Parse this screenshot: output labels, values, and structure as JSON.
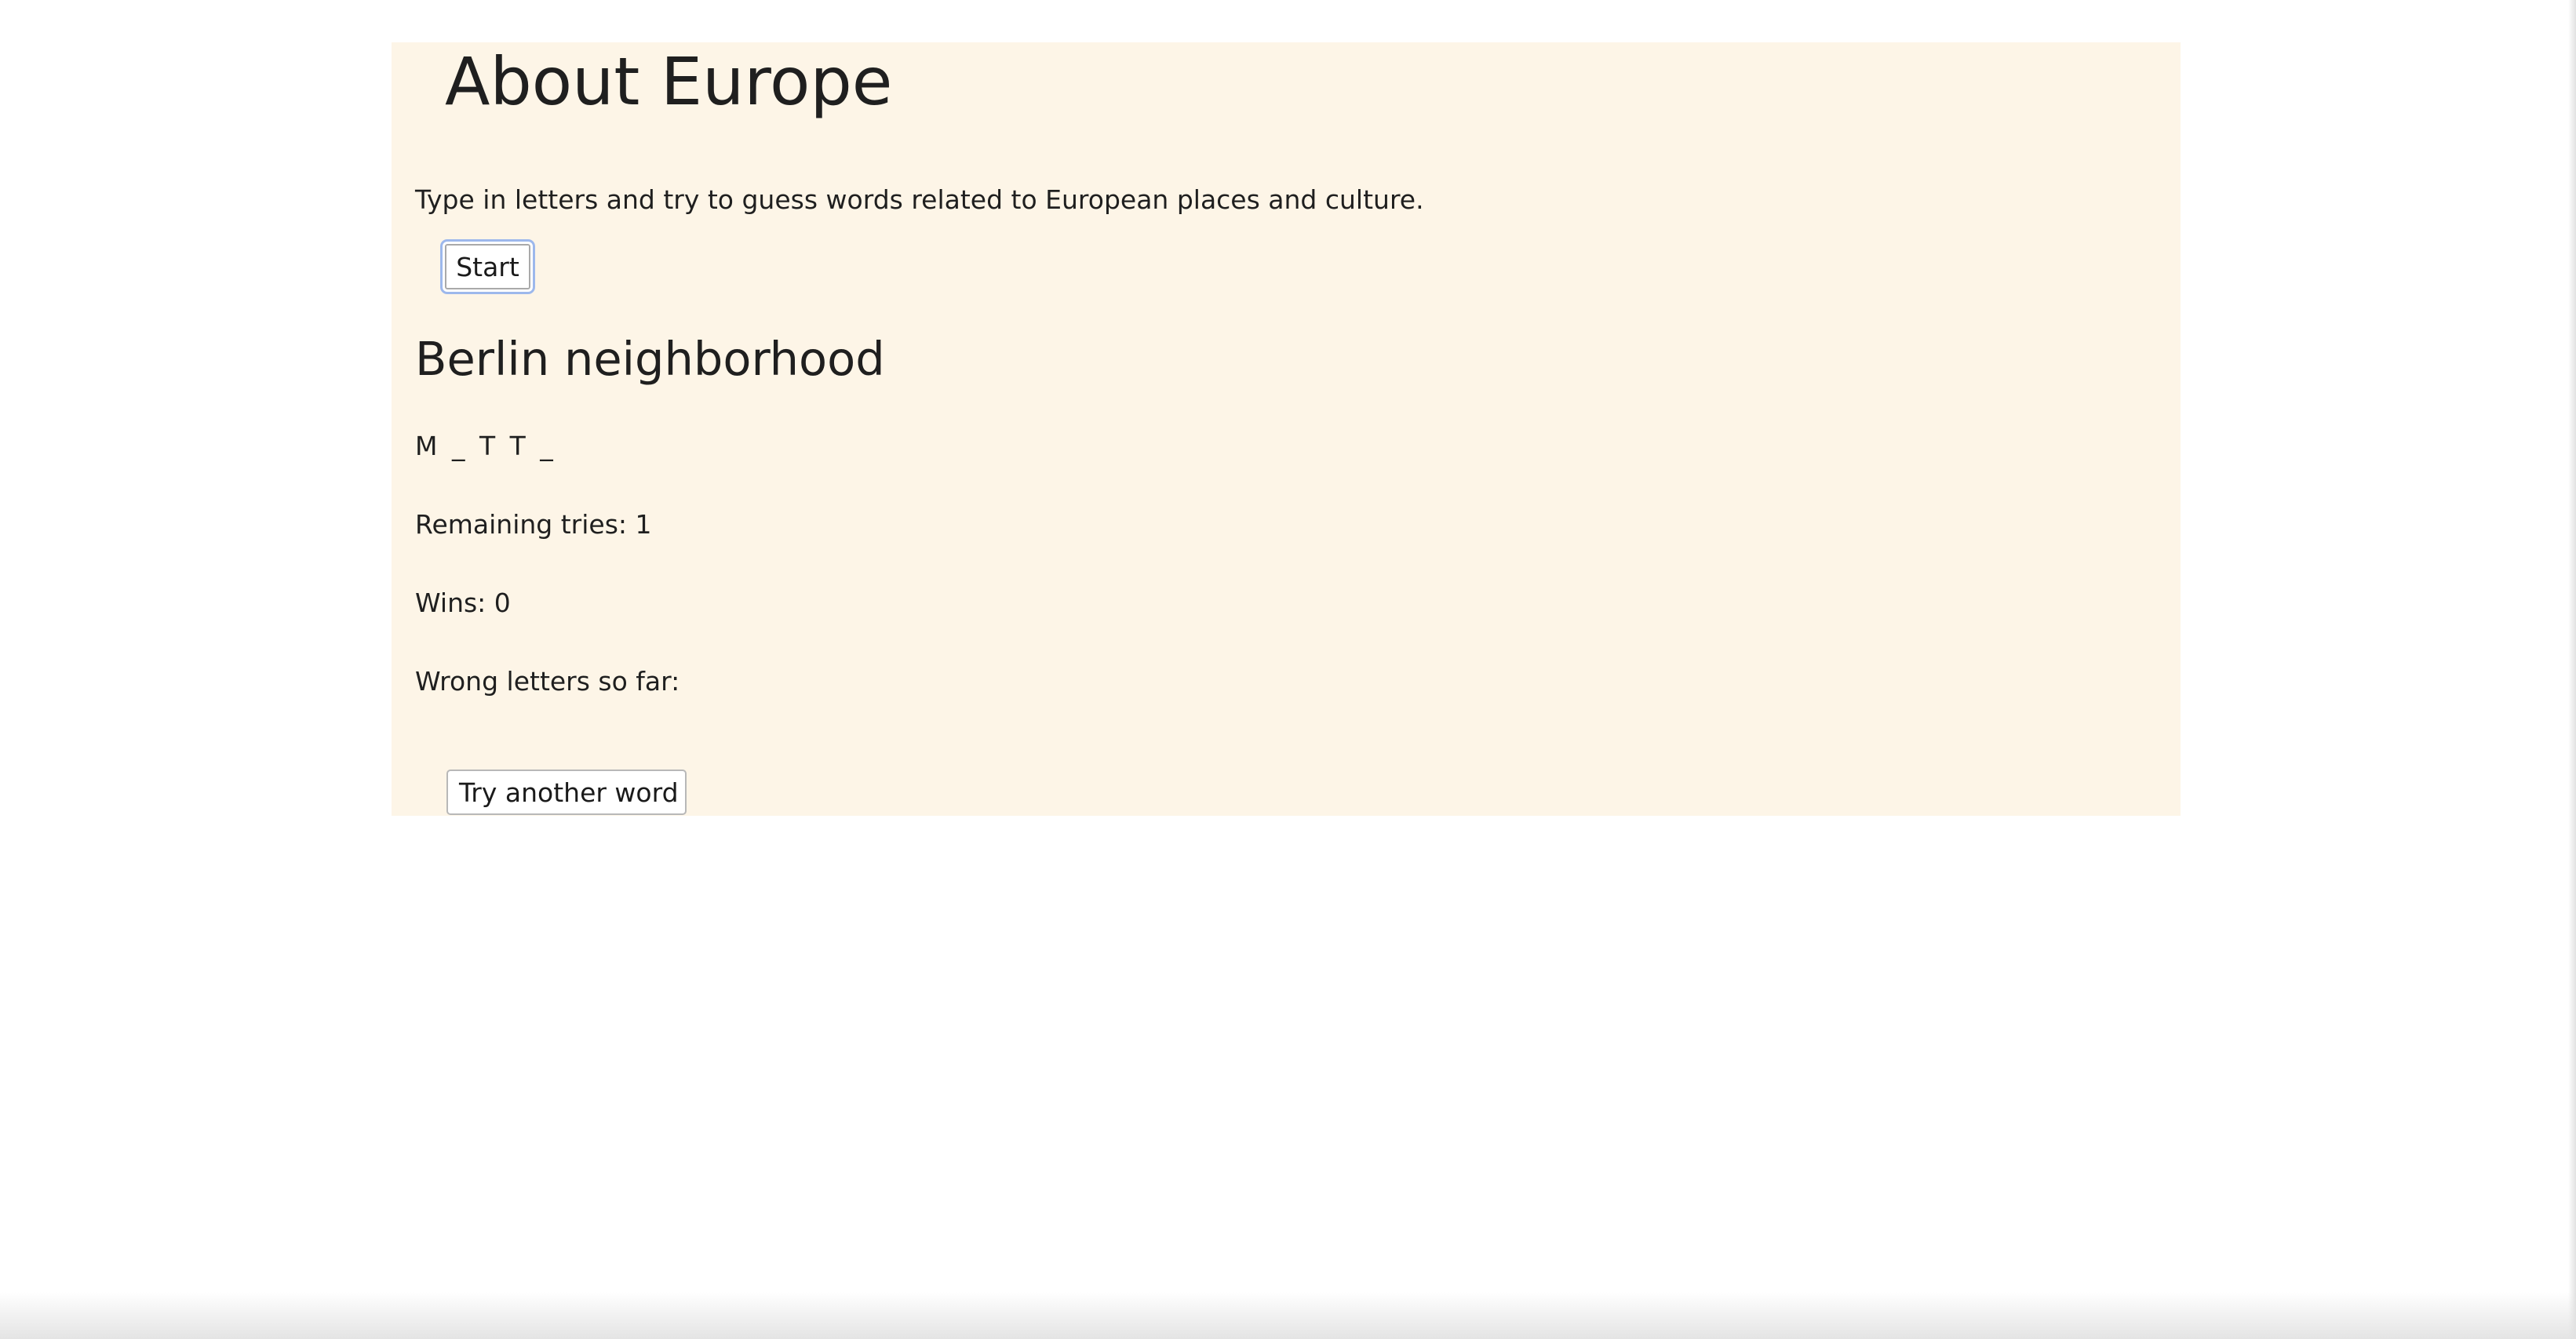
{
  "app": {
    "title": "About Europe",
    "intro": "Type in letters and try to guess words related to European places and culture."
  },
  "controls": {
    "start_label": "Start",
    "another_word_label": "Try another word"
  },
  "game": {
    "category": "Berlin neighborhood",
    "word_display": "M _ T T _",
    "remaining_tries": "Remaining tries: 1",
    "wins": "Wins: 0",
    "wrong_letters": "Wrong letters so far:"
  },
  "colors": {
    "panel_background": "#fdf5e7",
    "focus_ring": "#9db8ec",
    "text": "#1f1f1f"
  }
}
